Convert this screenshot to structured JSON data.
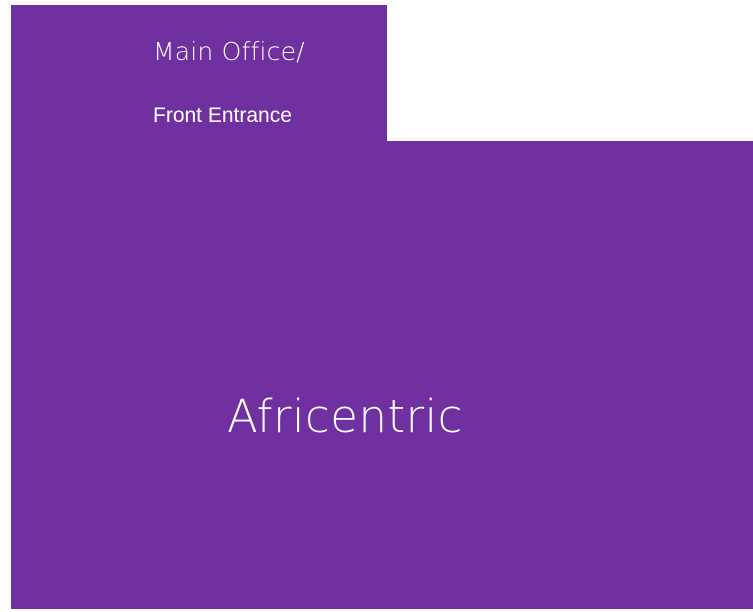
{
  "colors": {
    "room_fill": "#7030a0",
    "text": "#ffffff",
    "background": "#ffffff"
  },
  "entrance_room": {
    "line1": "Main Office/",
    "line2": "Front Entrance"
  },
  "main_room": {
    "label": "Africentric"
  }
}
